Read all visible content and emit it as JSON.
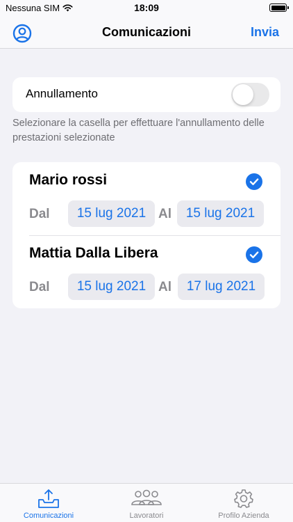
{
  "status_bar": {
    "carrier": "Nessuna SIM",
    "time": "18:09"
  },
  "nav": {
    "left_icon": "person-circle-icon",
    "title": "Comunicazioni",
    "action": "Invia"
  },
  "annullamento": {
    "label": "Annullamento",
    "enabled": false,
    "footnote": "Selezionare la casella per effettuare l'annullamento delle prestazioni selezionate"
  },
  "workers": [
    {
      "name": "Mario rossi",
      "selected": true,
      "from_label": "Dal",
      "from": "15 lug 2021",
      "to_label": "Al",
      "to": "15 lug 2021"
    },
    {
      "name": "Mattia Dalla Libera",
      "selected": true,
      "from_label": "Dal",
      "from": "15 lug 2021",
      "to_label": "Al",
      "to": "17 lug 2021"
    }
  ],
  "tabs": [
    {
      "label": "Comunicazioni",
      "icon": "tray-upload-icon",
      "active": true
    },
    {
      "label": "Lavoratori",
      "icon": "people-group-icon",
      "active": false
    },
    {
      "label": "Profilo Azienda",
      "icon": "gear-icon",
      "active": false
    }
  ],
  "colors": {
    "accent": "#1a73e8",
    "background": "#f2f2f7",
    "secondary_text": "#8a8a8e"
  }
}
